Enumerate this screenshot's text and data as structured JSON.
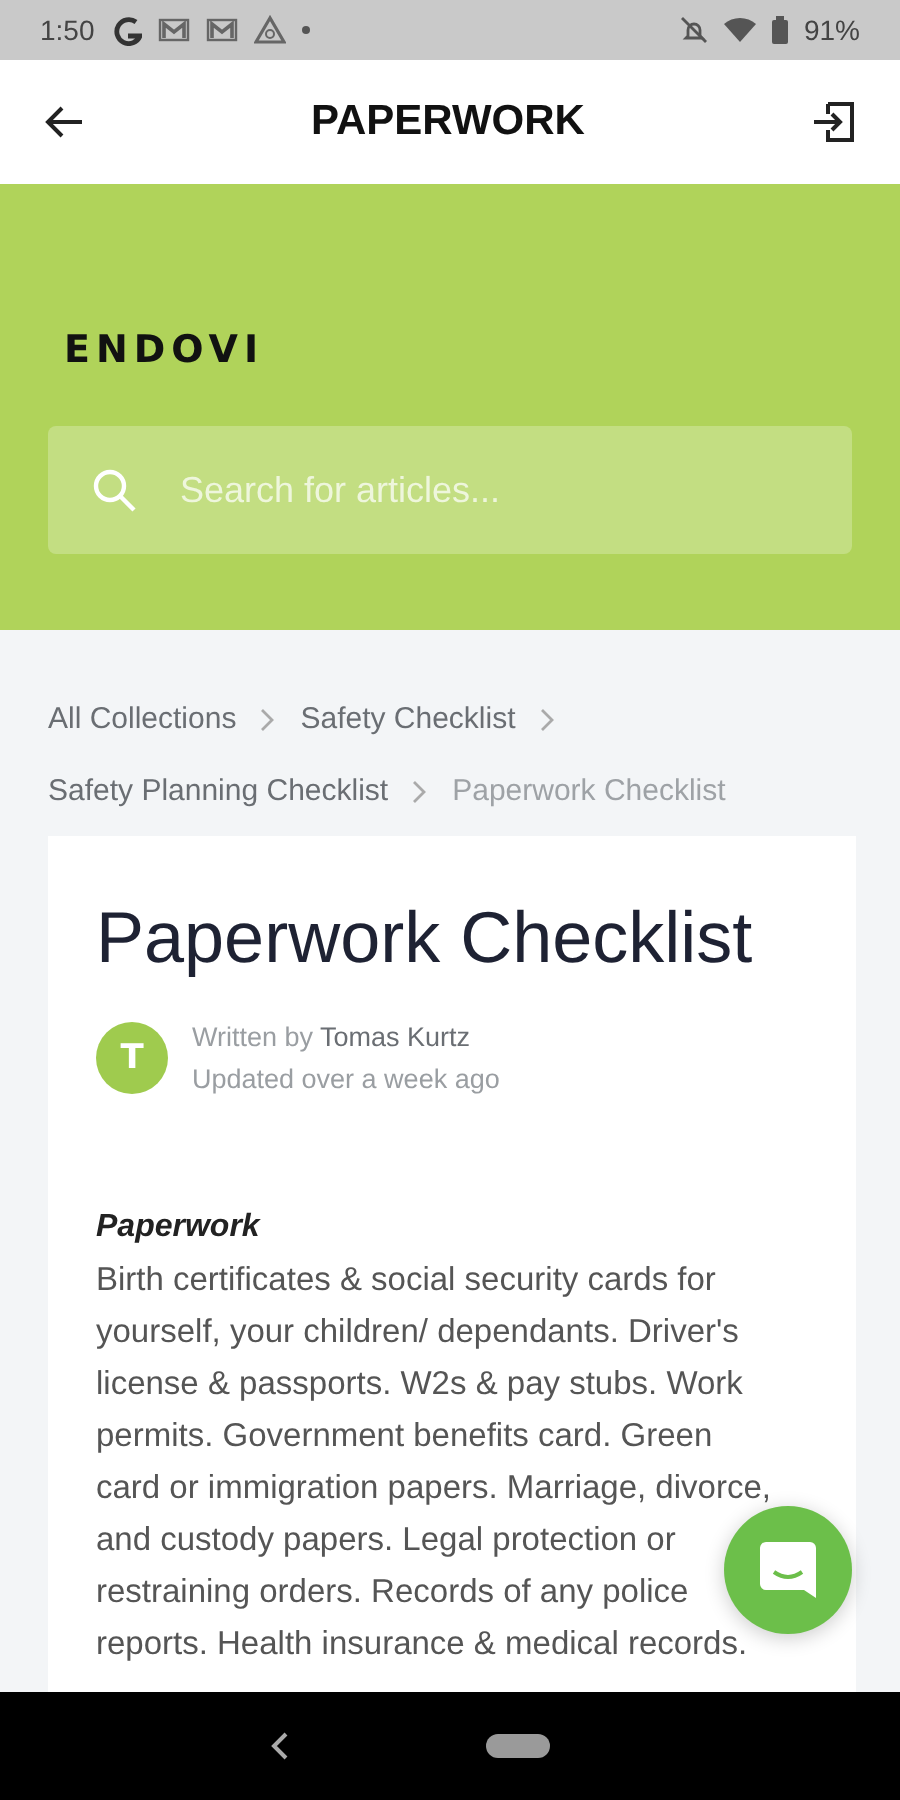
{
  "status_bar": {
    "time": "1:50",
    "battery": "91%"
  },
  "app_bar": {
    "title": "PAPERWORK"
  },
  "header": {
    "logo": "ENDOVI",
    "search": {
      "placeholder": "Search for articles..."
    }
  },
  "breadcrumbs": [
    {
      "label": "All Collections",
      "current": false
    },
    {
      "label": "Safety Checklist",
      "current": false
    },
    {
      "label": "Safety Planning Checklist",
      "current": false
    },
    {
      "label": "Paperwork Checklist",
      "current": true
    }
  ],
  "article": {
    "title": "Paperwork Checklist",
    "author": {
      "initial": "T",
      "prefix": "Written by",
      "name": "Tomas Kurtz"
    },
    "updated": "Updated over a week ago",
    "section_heading": "Paperwork",
    "body_lines": [
      "Birth certificates & social security cards for",
      "yourself, your children/ dependants. Driver's",
      "license & passports. W2s & pay stubs. Work",
      "permits. Government benefits card. Green",
      "card or immigration papers. Marriage, divorce,",
      "and custody papers. Legal protection or",
      "restraining orders. Records of any police",
      "reports. Health insurance & medical records."
    ]
  }
}
